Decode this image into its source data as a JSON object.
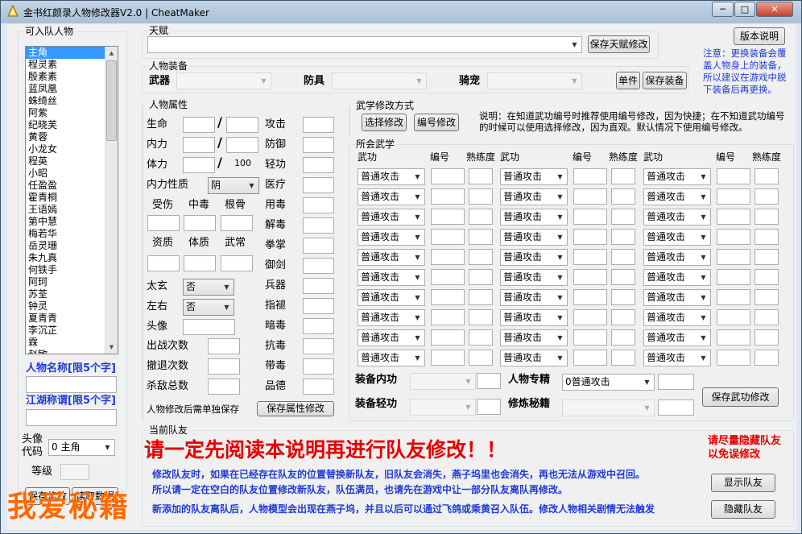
{
  "window": {
    "title": "金书红颜录人物修改器V2.0 | CheatMaker",
    "min": "─",
    "max": "□",
    "close": "✕"
  },
  "roster": {
    "legend": "可入队人物",
    "items": [
      "主角",
      "程灵素",
      "殷素素",
      "蓝凤凰",
      "蛛绮丝",
      "阿紫",
      "纪晓芙",
      "黄蓉",
      "小龙女",
      "程英",
      "小昭",
      "任盈盈",
      "霍青桐",
      "王语嫣",
      "第中慧",
      "梅若华",
      "岳灵珊",
      "朱九真",
      "何铁手",
      "阿珂",
      "苏荃",
      "钟灵",
      "夏青青",
      "李沉芷",
      "霖",
      "赵敏"
    ],
    "selected_index": 0,
    "name_label": "人物名称[限5个字]",
    "title_label": "江湖称谓[限5个字]",
    "avatar_label": "头像\n代码",
    "avatar_value": "0 主角",
    "level_label": "等级"
  },
  "talent": {
    "legend": "天赋",
    "save_button": "保存天赋修改"
  },
  "version_button": "版本说明",
  "note": "注意：更换装备会覆盖人物身上的装备，所以建议在游戏中脱下装备后再更换。",
  "equipment": {
    "legend": "人物装备",
    "weapon": "武器",
    "armor": "防具",
    "mount": "骑宠",
    "single_button": "单件",
    "save_button": "保存装备"
  },
  "attributes": {
    "legend": "人物属性",
    "hp": "生命",
    "mp": "内力",
    "stamina": "体力",
    "stamina_max": "100",
    "nature": "内力性质",
    "nature_value": "阴",
    "injury": "受伤",
    "poison": "中毒",
    "root": "根骨",
    "aptitude": "资质",
    "physique": "体质",
    "martial": "武常",
    "taixuan": "太玄",
    "taixuan_value": "否",
    "zuoyou": "左右",
    "zuoyou_value": "否",
    "portrait": "头像",
    "battles": "出战次数",
    "retreats": "撤退次数",
    "kills": "杀敌总数",
    "tip": "人物修改后需单独保存",
    "save_button": "保存属性修改",
    "right_labels": [
      "攻击",
      "防御",
      "轻功",
      "医疗",
      "用毒",
      "解毒",
      "拳掌",
      "御剑",
      "兵器",
      "指褪",
      "暗毒",
      "抗毒",
      "带毒",
      "品德"
    ]
  },
  "skill_mode": {
    "legend": "武学修改方式",
    "select_button": "选择修改",
    "number_button": "编号修改",
    "explain": "说明：在知道武功编号时推荐使用编号修改，因为快捷；在不知道武功编号的时候可以使用选择修改，因为直观。默认情况下使用编号修改。"
  },
  "skills": {
    "legend": "所会武学",
    "col_skill": "武功",
    "col_no": "编号",
    "col_prof": "熟练度",
    "default_skill": "普通攻击",
    "rows": 10,
    "equip_inner": "装备内功",
    "equip_light": "装备轻功",
    "specialty": "人物专精",
    "specialty_value": "0普通攻击",
    "book": "修炼秘籍",
    "save_button": "保存武功修改"
  },
  "party": {
    "legend": "当前队友",
    "headline": "请一定先阅读本说明再进行队友修改！！",
    "side_note": "请尽量隐藏队友以免误修改",
    "show_button": "显示队友",
    "hide_button": "隐藏队友",
    "lines": [
      "修改队友时，如果在已经存在队友的位置替换新队友，旧队友会消失，燕子坞里也会消失，再也无法从游戏中召回。",
      "所以请一定在空白的队友位置修改新队友，队伍满员，也请先在游戏中让一部分队友离队再修改。",
      "新添加的队友离队后，人物模型会出现在燕子坞，并且以后可以通过飞鸽或乘黄召入队伍。修改人物相关剧情无法触发"
    ]
  },
  "bottom_buttons": [
    "保存修改",
    "读取数据"
  ],
  "watermark": "我爱秘籍",
  "colors": {
    "accent_blue": "#1f3bd6",
    "warning_red": "#e60000",
    "watermark_orange": "#ff6a00"
  }
}
